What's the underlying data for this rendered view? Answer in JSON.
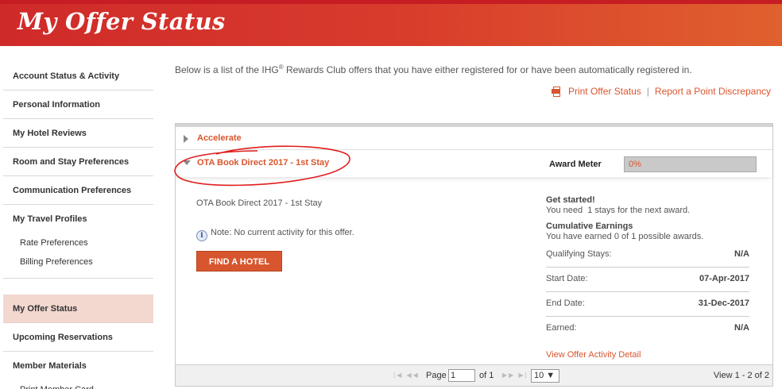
{
  "header": {
    "title": "My Offer Status"
  },
  "sidebar": {
    "items": [
      {
        "label": "Account Status & Activity"
      },
      {
        "label": "Personal Information"
      },
      {
        "label": "My Hotel Reviews"
      },
      {
        "label": "Room and Stay Preferences"
      },
      {
        "label": "Communication Preferences"
      }
    ],
    "travel_profiles": {
      "label": "My Travel Profiles",
      "subitems": [
        "Rate Preferences",
        "Billing Preferences"
      ]
    },
    "offer_status": "My Offer Status",
    "upcoming": "Upcoming Reservations",
    "member_materials": {
      "label": "Member Materials",
      "subitems": [
        "Print Member Card"
      ]
    }
  },
  "intro": {
    "text_before": "Below is a list of the IHG",
    "registered_mark": "®",
    "text_after": " Rewards Club offers that you have either registered for or have been automatically registered in."
  },
  "links": {
    "print": "Print Offer Status",
    "separator": "|",
    "report": "Report a Point Discrepancy"
  },
  "offers": {
    "accelerate": "Accelerate",
    "active_offer": "OTA Book Direct 2017 - 1st Stay",
    "award_meter_label": "Award Meter",
    "award_meter_value": "0%",
    "award_meter_fraction": 0,
    "detail_title": "OTA Book Direct 2017 - 1st Stay",
    "note": "Note: No current activity for this offer.",
    "find_hotel": "FIND A HOTEL",
    "get_started_title": "Get started!",
    "get_started_text": "You need  1 stays for the next award.",
    "cumulative_title": "Cumulative Earnings",
    "cumulative_text": "You have earned 0 of 1 possible awards.",
    "stats": [
      {
        "label": "Qualifying Stays:",
        "value": "N/A"
      },
      {
        "label": "Start Date:",
        "value": "07-Apr-2017"
      },
      {
        "label": "End Date:",
        "value": "31-Dec-2017"
      },
      {
        "label": "Earned:",
        "value": "N/A"
      }
    ],
    "activity_link": "View Offer Activity Detail"
  },
  "pager": {
    "page_label": "Page",
    "page_value": "1",
    "of_label": "of 1",
    "per_page": "10 ▼",
    "view_text": "View 1 - 2 of 2"
  },
  "colors": {
    "brand_red": "#cf2a2a",
    "link_orange": "#d8562e",
    "active_bg": "#f3d8d0",
    "annotation_red": "#e01e1e"
  }
}
